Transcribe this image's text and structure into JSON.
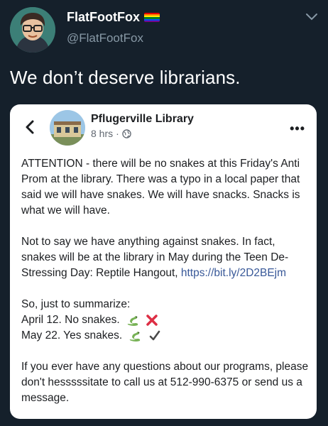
{
  "tweet": {
    "display_name": "FlatFootFox",
    "handle": "@FlatFootFox",
    "text": "We don’t deserve librarians."
  },
  "post": {
    "page_name": "Pflugerville Library",
    "time": "8 hrs",
    "separator": "·",
    "paragraph1": "ATTENTION - there will be no snakes at this Friday's Anti Prom at the library. There was a typo in a local paper that said we will have snakes. We will have snacks. Snacks is what we will have.",
    "paragraph2_text": "Not to say we have anything against snakes. In fact, snakes will be at the library in May during the Teen De-Stressing Day: Reptile Hangout, ",
    "paragraph2_link": "https://bit.ly/2D2BEjm",
    "summary_intro": "So, just to summarize:",
    "summary_line1": "April 12. No snakes.",
    "summary_line2": "May 22. Yes snakes.",
    "closing": "If you ever have any questions about our programs, please don't hesssssitate to call us at 512-990-6375 or send us a message."
  },
  "icons": {
    "pride_flag": "rainbow-flag-icon",
    "caret": "chevron-down-icon",
    "back": "chevron-left-icon",
    "globe": "globe-icon",
    "more": "more-horizontal-icon",
    "snake": "snake-icon",
    "cross": "red-x-icon",
    "check": "check-icon"
  },
  "colors": {
    "background": "#15202b",
    "muted_text": "#8899a6",
    "link": "#385898",
    "x_mark": "#dd2e44"
  }
}
